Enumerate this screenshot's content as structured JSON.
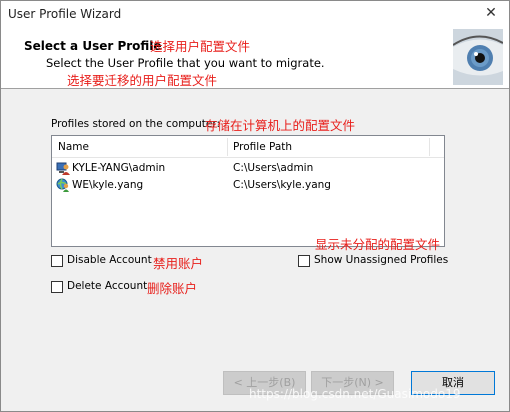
{
  "window": {
    "title": "User Profile Wizard",
    "close_glyph": "✕"
  },
  "header": {
    "title": "Select a User Profile",
    "title_note": "选择用户配置文件",
    "subtitle": "Select the User Profile that you want to migrate.",
    "subtitle_note": "选择要迁移的用户配置文件"
  },
  "profiles": {
    "label": "Profiles stored on the computer:",
    "label_note": "存储在计算机上的配置文件",
    "columns": [
      "Name",
      "Profile Path"
    ],
    "rows": [
      {
        "name": "KYLE-YANG\\admin",
        "path": "C:\\Users\\admin",
        "icon": "local-user-icon"
      },
      {
        "name": "WE\\kyle.yang",
        "path": "C:\\Users\\kyle.yang",
        "icon": "domain-user-icon"
      }
    ]
  },
  "options": {
    "disable_account": "Disable Account",
    "disable_note": "禁用账户",
    "delete_account": "Delete Account",
    "delete_note": "删除账户",
    "show_unassigned": "Show Unassigned Profiles",
    "show_unassigned_note": "显示未分配的配置文件"
  },
  "buttons": {
    "back": "< 上一步(B)",
    "next": "下一步(N) >",
    "cancel": "取消"
  },
  "watermark": "https://blog.csdn.net/Guasimodo19",
  "colors": {
    "annotation": "#e8201c",
    "accent": "#0078d7"
  }
}
